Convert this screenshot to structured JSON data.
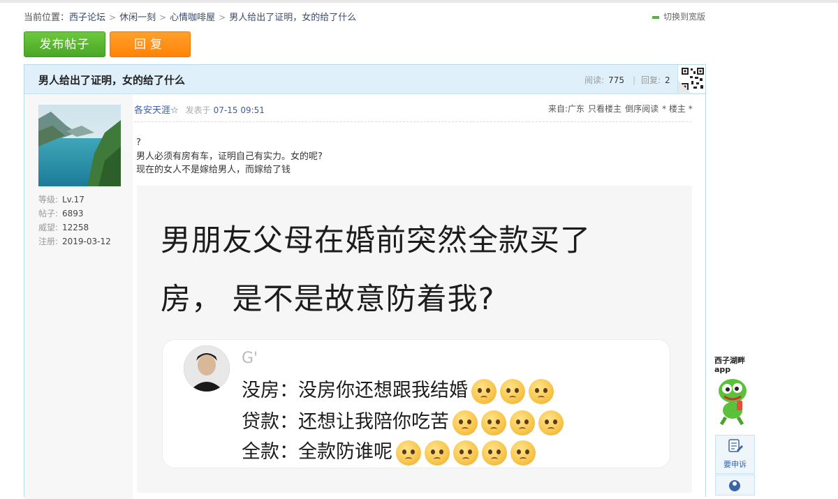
{
  "breadcrumb": {
    "prefix": "当前位置：",
    "items": [
      "西子论坛",
      "休闲一刻",
      "心情咖啡屋",
      "男人给出了证明，女的给了什么"
    ],
    "separator": ">"
  },
  "view_toggle": "切换到宽版",
  "actions": {
    "post": "发布帖子",
    "reply": "回复"
  },
  "thread": {
    "title": "男人给出了证明，女的给了什么",
    "reads_label": "阅读:",
    "reads": "775",
    "replies_label": "回复:",
    "replies": "2"
  },
  "author": {
    "name": "各安天涯☆",
    "profile": [
      {
        "key": "等级:",
        "value": "Lv.17"
      },
      {
        "key": "帖子:",
        "value": "6893"
      },
      {
        "key": "威望:",
        "value": "12258"
      },
      {
        "key": "注册:",
        "value": "2019-03-12"
      }
    ]
  },
  "post": {
    "posted_label": "发表于",
    "posted_time": "07-15 09:51",
    "tools": [
      "来自:广东",
      "只看楼主",
      "倒序阅读",
      "* 楼主 *"
    ],
    "lines": [
      "?",
      "男人必须有房有车，证明自己有实力。女的呢?",
      "现在的女人不是嫁给男人，而嫁给了钱"
    ]
  },
  "image": {
    "headline_1": "男朋友父母在婚前突然全款买了",
    "headline_2": "房， 是不是故意防着我?",
    "commenter": "G'",
    "comments": [
      {
        "text": "没房：没房你还想跟我结婚",
        "emoji_count": 3
      },
      {
        "text": "贷款：还想让我陪你吃苦",
        "emoji_count": 4
      },
      {
        "text": "全款：全款防谁呢",
        "emoji_count": 5
      }
    ],
    "emoji_icon": "worried-pleading-face-icon"
  },
  "sidebar": {
    "app_name": "西子湖畔",
    "app_label": "app",
    "complaint": "要申诉"
  },
  "colors": {
    "post_button": "#55b02e",
    "reply_button": "#ff8c16",
    "header_bg": "#dff0fa",
    "link": "#3a5da8"
  }
}
